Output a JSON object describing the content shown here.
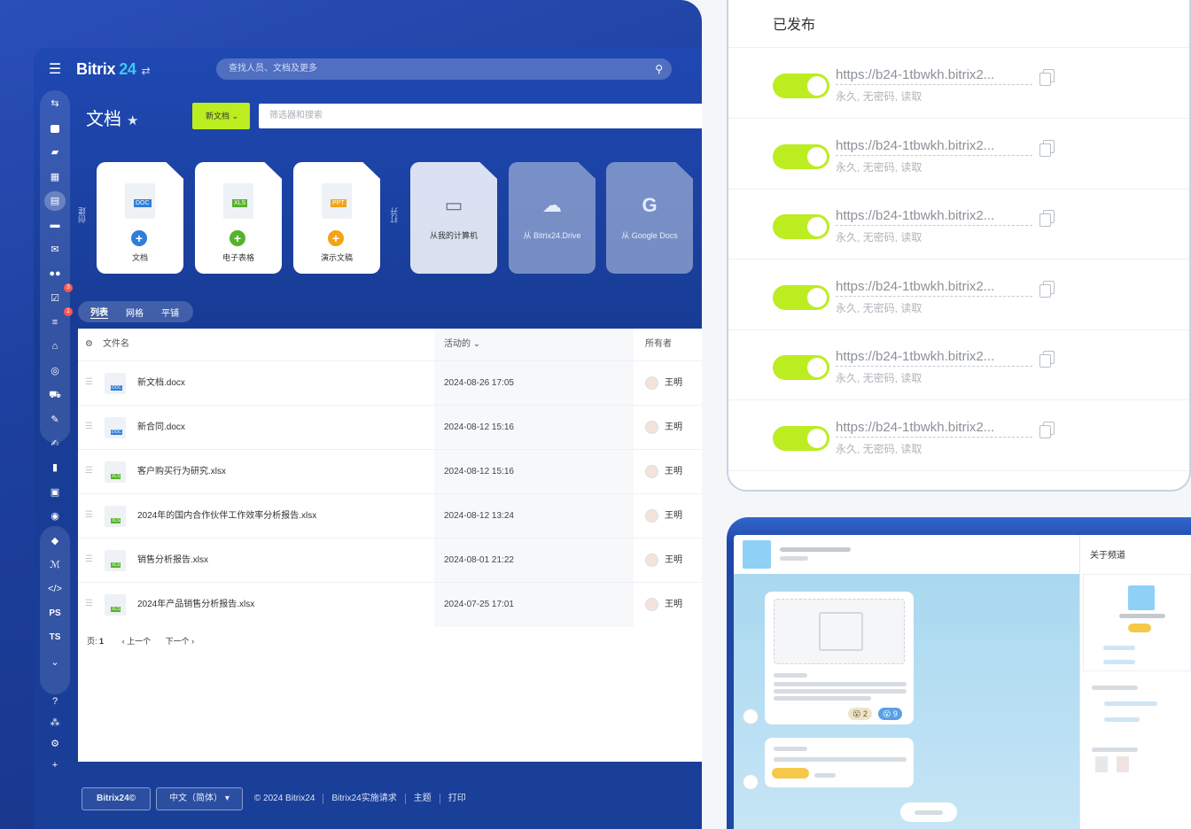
{
  "app": {
    "brand": "Bitrix",
    "brand_num": "24",
    "brand_switch": "⇄",
    "menu_icon": "hamburger-icon"
  },
  "search": {
    "placeholder": "查找人员、文档及更多"
  },
  "page": {
    "title": "文档",
    "new_doc_label": "新文档",
    "filter_placeholder": "筛选器和搜索"
  },
  "create_label": "创建",
  "open_label": "打开",
  "create_cards": [
    {
      "badge": "DOC",
      "label": "文档",
      "color": "#2f7ed8",
      "plus": "#2f7ed8"
    },
    {
      "badge": "XLS",
      "label": "电子表格",
      "color": "#55b32b",
      "plus": "#55b32b"
    },
    {
      "badge": "PPT",
      "label": "演示文稿",
      "color": "#f2a417",
      "plus": "#f2a417"
    }
  ],
  "open_cards": [
    {
      "label": "从我的计算机",
      "icon": "drive-icon"
    },
    {
      "label": "从 Bitrix24.Drive",
      "icon": "cloud-icon"
    },
    {
      "label": "从 Google Docs",
      "icon": "google-icon"
    }
  ],
  "view_tabs": [
    "列表",
    "网格",
    "平铺"
  ],
  "table": {
    "headers": {
      "name": "文件名",
      "activity": "活动的",
      "owner": "所有者"
    },
    "rows": [
      {
        "type": "DOC",
        "name": "新文档.docx",
        "date": "2024-08-26 17:05",
        "owner": "王明"
      },
      {
        "type": "DOC",
        "name": "新合同.docx",
        "date": "2024-08-12 15:16",
        "owner": "王明"
      },
      {
        "type": "XLS",
        "name": "客户购买行为研究.xlsx",
        "date": "2024-08-12 15:16",
        "owner": "王明"
      },
      {
        "type": "XLS",
        "name": "2024年的国内合作伙伴工作效率分析报告.xlsx",
        "date": "2024-08-12 13:24",
        "owner": "王明"
      },
      {
        "type": "XLS",
        "name": "销售分析报告.xlsx",
        "date": "2024-08-01 21:22",
        "owner": "王明"
      },
      {
        "type": "XLS",
        "name": "2024年产品销售分析报告.xlsx",
        "date": "2024-07-25 17:01",
        "owner": "王明"
      }
    ],
    "pager": {
      "page_label": "页:",
      "page": "1",
      "prev": "上一个",
      "next": "下一个"
    }
  },
  "sidebar_badges": {
    "tasks": "3",
    "filters": "1"
  },
  "sidebar_text": {
    "ps": "PS",
    "ts": "TS"
  },
  "footer": {
    "brand": "Bitrix24©",
    "language": "中文（简体）",
    "copyright": "© 2024 Bitrix24",
    "impl": "Bitrix24实施请求",
    "theme": "主题",
    "print": "打印"
  },
  "published": {
    "title": "已发布",
    "items": [
      {
        "url": "https://b24-1tbwkh.bitrix2...",
        "meta": "永久, 无密码, 读取",
        "enabled": true
      },
      {
        "url": "https://b24-1tbwkh.bitrix2...",
        "meta": "永久, 无密码, 读取",
        "enabled": true
      },
      {
        "url": "https://b24-1tbwkh.bitrix2...",
        "meta": "永久, 无密码, 读取",
        "enabled": true
      },
      {
        "url": "https://b24-1tbwkh.bitrix2...",
        "meta": "永久, 无密码, 读取",
        "enabled": true
      },
      {
        "url": "https://b24-1tbwkh.bitrix2...",
        "meta": "永久, 无密码, 读取",
        "enabled": true
      },
      {
        "url": "https://b24-1tbwkh.bitrix2...",
        "meta": "永久, 无密码, 读取",
        "enabled": true
      }
    ]
  },
  "channel": {
    "about_label": "关于频道",
    "reaction_a": "2",
    "reaction_b": "9"
  },
  "colors": {
    "accent": "#bbed21",
    "brand_blue": "#1f48b2",
    "link_blue": "#3bc8f5"
  }
}
